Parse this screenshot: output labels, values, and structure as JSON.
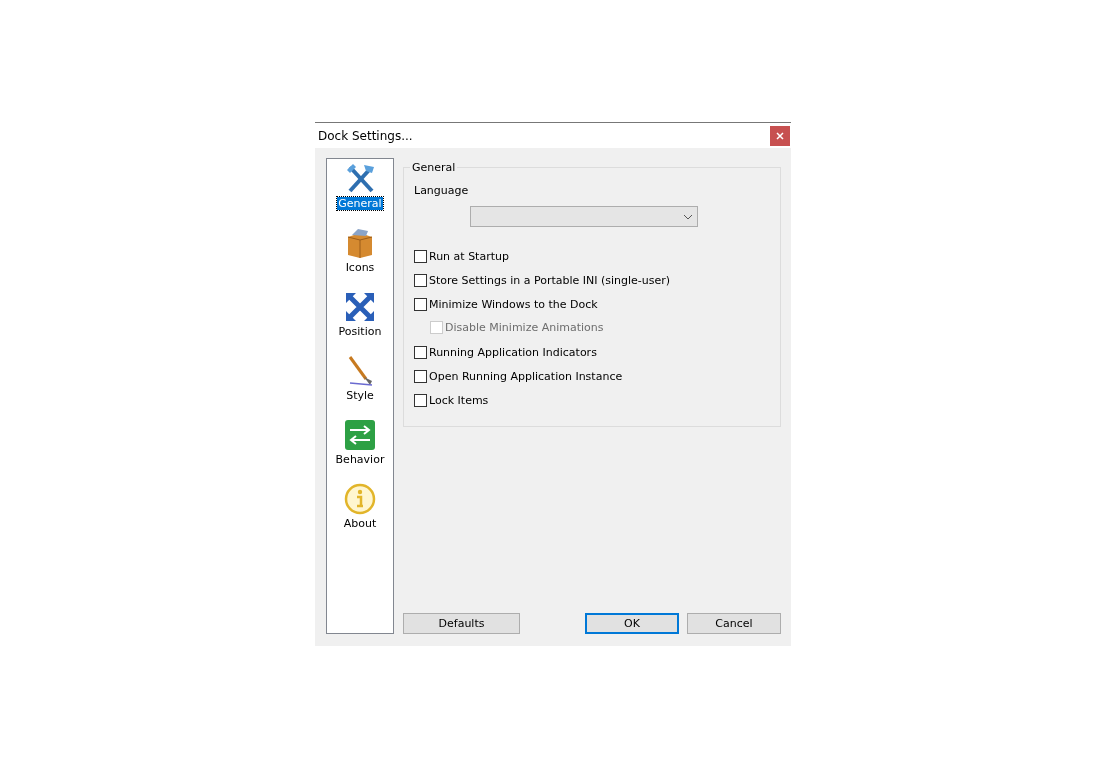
{
  "window": {
    "title": "Dock Settings..."
  },
  "sidebar": {
    "items": [
      {
        "label": "General",
        "selected": true
      },
      {
        "label": "Icons",
        "selected": false
      },
      {
        "label": "Position",
        "selected": false
      },
      {
        "label": "Style",
        "selected": false
      },
      {
        "label": "Behavior",
        "selected": false
      },
      {
        "label": "About",
        "selected": false
      }
    ]
  },
  "group": {
    "title": "General",
    "language_label": "Language",
    "options": [
      {
        "label": "Run at Startup",
        "checked": false,
        "disabled": false
      },
      {
        "label": "Store Settings in a Portable INI (single-user)",
        "checked": false,
        "disabled": false
      },
      {
        "label": "Minimize Windows to the Dock",
        "checked": false,
        "disabled": false,
        "children": [
          {
            "label": "Disable Minimize Animations",
            "checked": false,
            "disabled": true
          }
        ]
      },
      {
        "label": "Running Application Indicators",
        "checked": false,
        "disabled": false
      },
      {
        "label": "Open Running Application Instance",
        "checked": false,
        "disabled": false
      },
      {
        "label": "Lock Items",
        "checked": false,
        "disabled": false
      }
    ]
  },
  "buttons": [
    {
      "label": "Defaults",
      "default": false
    },
    {
      "label": "OK",
      "default": true
    },
    {
      "label": "Cancel",
      "default": false
    }
  ]
}
